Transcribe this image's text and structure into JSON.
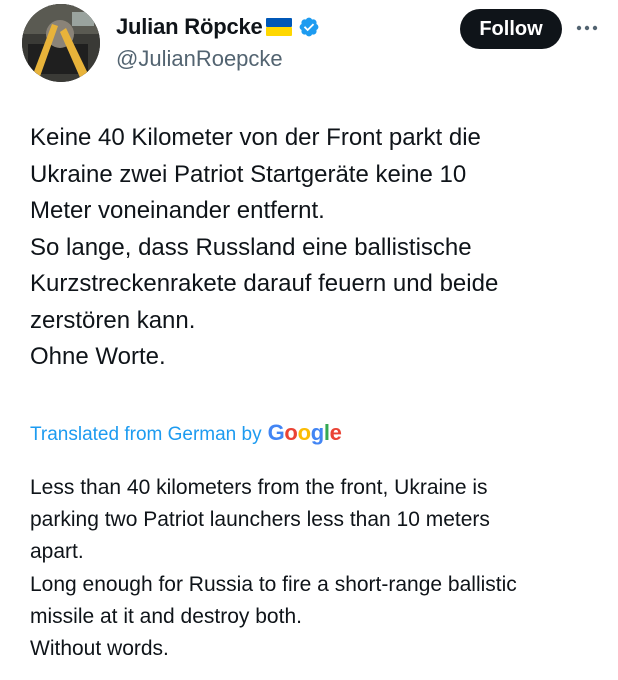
{
  "author": {
    "display_name": "Julian Röpcke",
    "handle": "@JulianRoepcke",
    "flag": "ukraine-flag-icon",
    "verified": true
  },
  "actions": {
    "follow_label": "Follow",
    "more_icon": "more-horizontal-icon"
  },
  "tweet": {
    "original_lines": [
      "Keine 40 Kilometer von der Front parkt die",
      "Ukraine zwei Patriot Startgeräte keine 10",
      "Meter voneinander entfernt.",
      "So lange, dass Russland eine ballistische",
      "Kurzstreckenrakete darauf feuern und beide",
      "zerstören kann.",
      "Ohne Worte."
    ],
    "translation_credit": "Translated from German by",
    "translation_provider": "Google",
    "translated_lines": [
      "Less than 40 kilometers from the front, Ukraine is",
      "parking two Patriot launchers less than 10 meters",
      "apart.",
      "Long enough for Russia to fire a short-range ballistic",
      "missile at it and destroy both.",
      "Without words."
    ]
  },
  "colors": {
    "text": "#0f1419",
    "secondary": "#536471",
    "link": "#1d9bf0",
    "follow_bg": "#0f1419",
    "verified": "#1d9bf0",
    "flag_blue": "#0057b7",
    "flag_yellow": "#ffd700",
    "google_blue": "#4285f4",
    "google_red": "#ea4335",
    "google_yellow": "#fbbc05",
    "google_green": "#34a853"
  }
}
